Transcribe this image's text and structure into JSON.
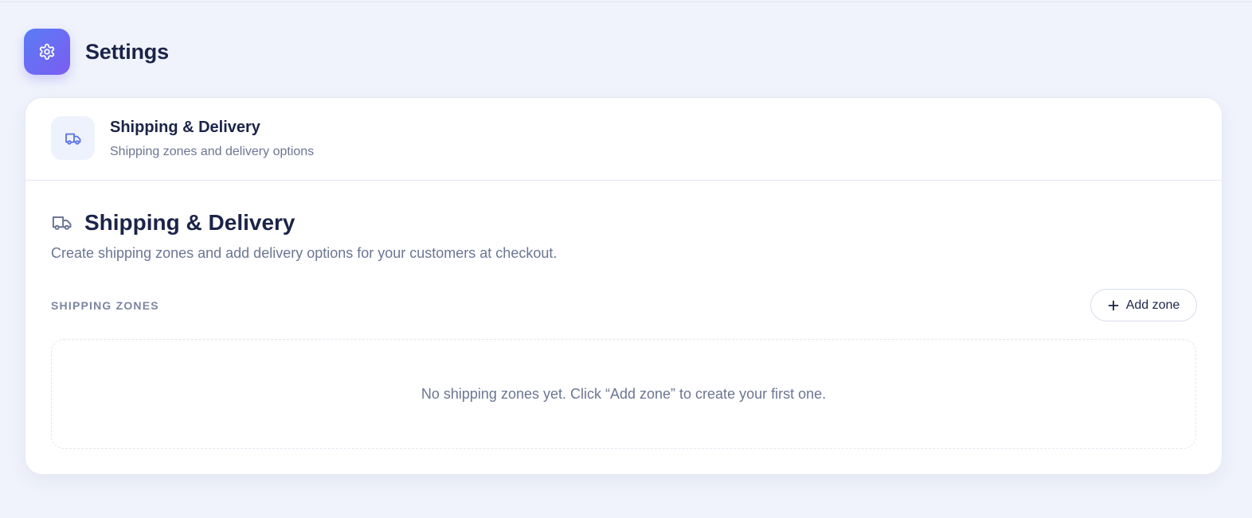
{
  "page": {
    "title": "Settings",
    "icon": "gear-icon",
    "accent": "#6a6cf3"
  },
  "section_card": {
    "icon": "truck-icon",
    "title": "Shipping & Delivery",
    "subtitle": "Shipping zones and delivery options"
  },
  "content": {
    "icon": "truck-icon",
    "title": "Shipping & Delivery",
    "description": "Create shipping zones and add delivery options for your customers at checkout.",
    "zones_label": "SHIPPING ZONES",
    "add_zone_label": "Add zone",
    "add_zone_icon": "plus-icon",
    "empty_message": "No shipping zones yet. Click “Add zone” to create your first one."
  }
}
